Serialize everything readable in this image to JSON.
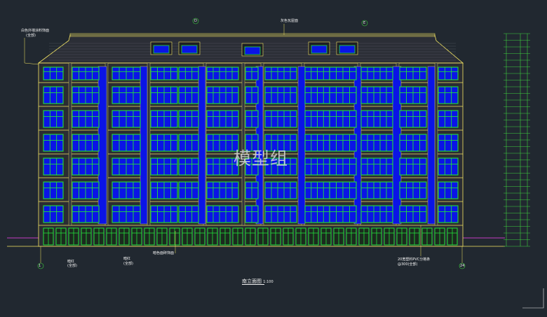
{
  "drawing": {
    "title": "南立面图",
    "scale": "1:100",
    "watermark": "模型组",
    "annotations": {
      "top_left": "白色外墙涂料饰面",
      "top_left_sub": "(全部)",
      "top_center": "灰色瓦屋面",
      "bottom_left_1": "暗红",
      "bottom_left_1_sub": "(全部)",
      "bottom_left_2": "暗红",
      "bottom_left_2_sub": "(全部)",
      "bottom_mid": "暗色面砖饰面",
      "bottom_right": "20宽塑料PVC分格条",
      "bottom_right_sub": "@300(全部)"
    },
    "axis_labels": {
      "left": "1",
      "right": "24",
      "top_a": "D",
      "top_b": "E"
    }
  },
  "colors": {
    "background": "#212830",
    "outline": "#f5e663",
    "glass": "#0a14e6",
    "frame": "#22e03a",
    "wall": "#2a2c33",
    "dimension": "#3fd13f",
    "magenta": "#c23cc2"
  }
}
